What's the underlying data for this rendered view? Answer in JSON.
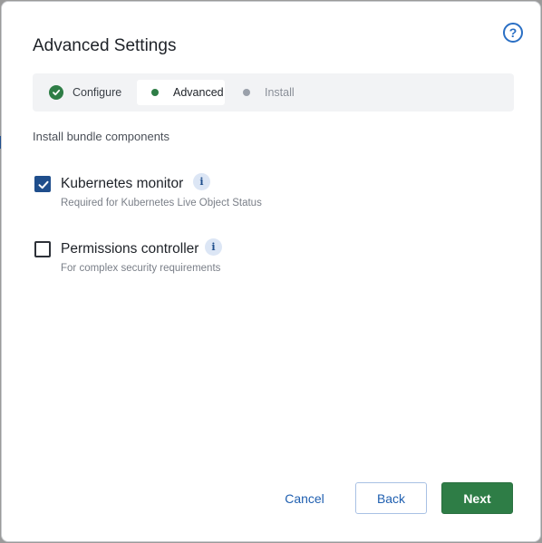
{
  "dialog": {
    "title": "Advanced Settings",
    "help_icon": "question-circle-icon",
    "help_glyph": "?"
  },
  "stepper": {
    "steps": [
      {
        "label": "Configure",
        "state": "complete",
        "icon": "check-circle-icon"
      },
      {
        "label": "Advanced",
        "state": "current",
        "icon": "dot-icon"
      },
      {
        "label": "Install",
        "state": "upcoming",
        "icon": "dot-icon"
      }
    ]
  },
  "section": {
    "label": "Install bundle components"
  },
  "options": [
    {
      "label": "Kubernetes monitor",
      "description": "Required for Kubernetes Live Object Status",
      "checked": true,
      "info_icon": "info-icon",
      "info_glyph": "i"
    },
    {
      "label": "Permissions controller",
      "description": "For complex security requirements",
      "checked": false,
      "info_icon": "info-icon",
      "info_glyph": "i"
    }
  ],
  "footer": {
    "cancel_label": "Cancel",
    "back_label": "Back",
    "next_label": "Next"
  },
  "colors": {
    "primary_green": "#2e7d46",
    "link_blue": "#1f5fb0",
    "checkbox_blue": "#1f4e8c"
  }
}
